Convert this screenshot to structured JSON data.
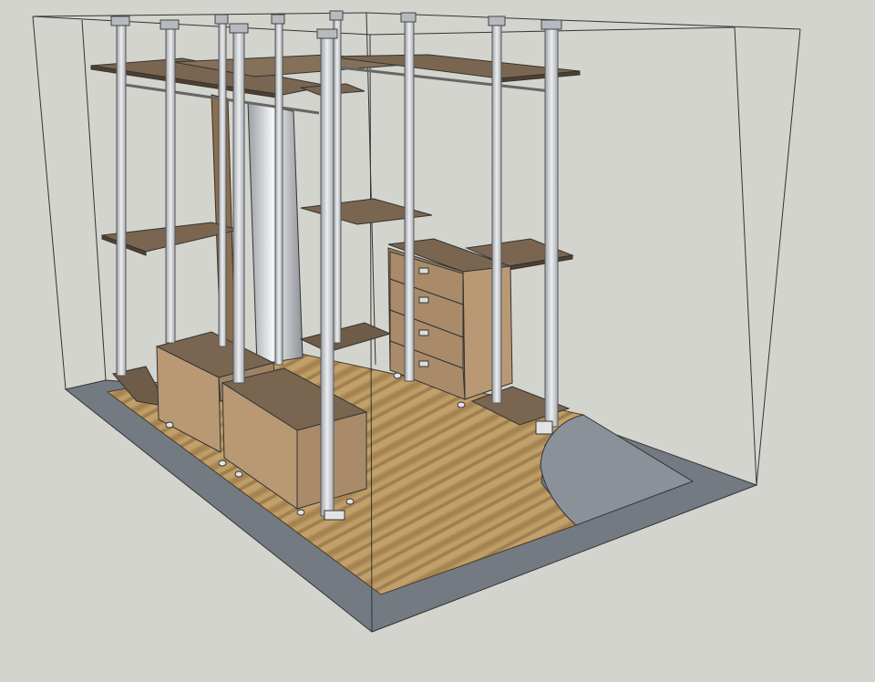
{
  "scene": {
    "subject": "walk-in-closet-3d-model",
    "palette": {
      "background": "#d4d4ce",
      "floor_slab": "#737a82",
      "floor_wood": "#b3925e",
      "shelf_top": "#7a6650",
      "shelf_edge": "#4e4030",
      "cabinet_side": "#b99874",
      "cabinet_front": "#9e8264",
      "pole": "#c9cbcf",
      "pole_shade": "#9da1a6",
      "mirror": "#e8e9eb",
      "outline": "#222222",
      "wire": "#333333",
      "door_arc": "#8a9199"
    },
    "icons": [
      "drawer-handle-icon"
    ]
  }
}
